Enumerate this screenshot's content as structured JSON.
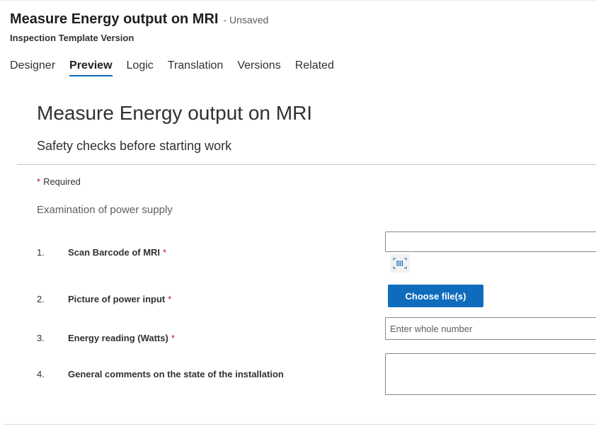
{
  "header": {
    "title": "Measure Energy output on MRI",
    "status": "- Unsaved",
    "subtitle": "Inspection Template Version"
  },
  "tabs": [
    {
      "label": "Designer",
      "active": false
    },
    {
      "label": "Preview",
      "active": true
    },
    {
      "label": "Logic",
      "active": false
    },
    {
      "label": "Translation",
      "active": false
    },
    {
      "label": "Versions",
      "active": false
    },
    {
      "label": "Related",
      "active": false
    }
  ],
  "form": {
    "title": "Measure Energy output on MRI",
    "description": "Safety checks before starting work",
    "required_marker": "*",
    "required_note": "Required",
    "section_title": "Examination of power supply",
    "questions": [
      {
        "number": "1.",
        "label": "Scan Barcode of MRI",
        "required": "*"
      },
      {
        "number": "2.",
        "label": "Picture of power input",
        "required": "*",
        "button_label": "Choose file(s)"
      },
      {
        "number": "3.",
        "label": "Energy reading (Watts)",
        "required": "*",
        "placeholder": "Enter whole number"
      },
      {
        "number": "4.",
        "label": "General comments on the state of the installation"
      }
    ]
  },
  "icons": {
    "barcode": "barcode-scan-icon"
  },
  "colors": {
    "accent": "#0f6cbd",
    "required": "#c50f1f"
  }
}
